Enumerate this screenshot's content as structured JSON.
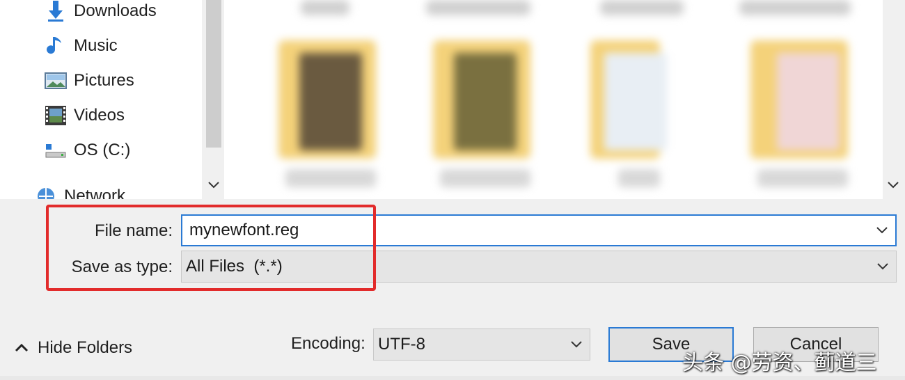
{
  "nav": {
    "items": [
      {
        "label": "Downloads",
        "icon": "download-arrow-icon"
      },
      {
        "label": "Music",
        "icon": "music-note-icon"
      },
      {
        "label": "Pictures",
        "icon": "pictures-icon"
      },
      {
        "label": "Videos",
        "icon": "videos-icon"
      },
      {
        "label": "OS (C:)",
        "icon": "drive-icon"
      },
      {
        "label": "Network",
        "icon": "network-icon"
      }
    ]
  },
  "form": {
    "filename_label": "File name:",
    "filename_value": "mynewfont.reg",
    "savetype_label": "Save as type:",
    "savetype_value": "All Files  (*.*)"
  },
  "footer": {
    "hide_folders": "Hide Folders",
    "encoding_label": "Encoding:",
    "encoding_value": "UTF-8",
    "save": "Save",
    "cancel": "Cancel"
  },
  "overlay": {
    "watermark": "头条 @劳资、蓟道三"
  },
  "colors": {
    "focus_blue": "#2a7ad4",
    "highlight_red": "#e22b2b",
    "folder_yellow": "#f4d27a"
  }
}
